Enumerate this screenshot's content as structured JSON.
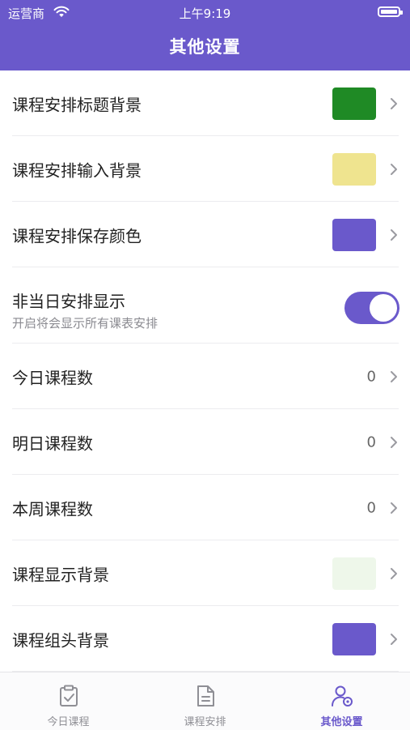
{
  "status_bar": {
    "carrier": "运营商",
    "time": "上午9:19"
  },
  "header": {
    "title": "其他设置"
  },
  "colors": {
    "accent": "#6a59cb",
    "green": "#1f8a25",
    "yellow": "#efe48f",
    "light_green": "#eef7ea"
  },
  "settings": {
    "title_bg": {
      "label": "课程安排标题背景",
      "color": "#1f8a25"
    },
    "input_bg": {
      "label": "课程安排输入背景",
      "color": "#efe48f"
    },
    "save_color": {
      "label": "课程安排保存颜色",
      "color": "#6a59cb"
    },
    "non_today": {
      "label": "非当日安排显示",
      "sublabel": "开启将会显示所有课表安排",
      "enabled": true
    },
    "today_count": {
      "label": "今日课程数",
      "value": "0"
    },
    "tomorrow_count": {
      "label": "明日课程数",
      "value": "0"
    },
    "week_count": {
      "label": "本周课程数",
      "value": "0"
    },
    "display_bg": {
      "label": "课程显示背景",
      "color": "#eef7ea"
    },
    "group_header_bg": {
      "label": "课程组头背景",
      "color": "#6a59cb"
    }
  },
  "tabbar": {
    "today": {
      "label": "今日课程",
      "icon": "clipboard-check-icon"
    },
    "schedule": {
      "label": "课程安排",
      "icon": "document-icon"
    },
    "settings": {
      "label": "其他设置",
      "icon": "user-gear-icon",
      "active": true
    }
  }
}
